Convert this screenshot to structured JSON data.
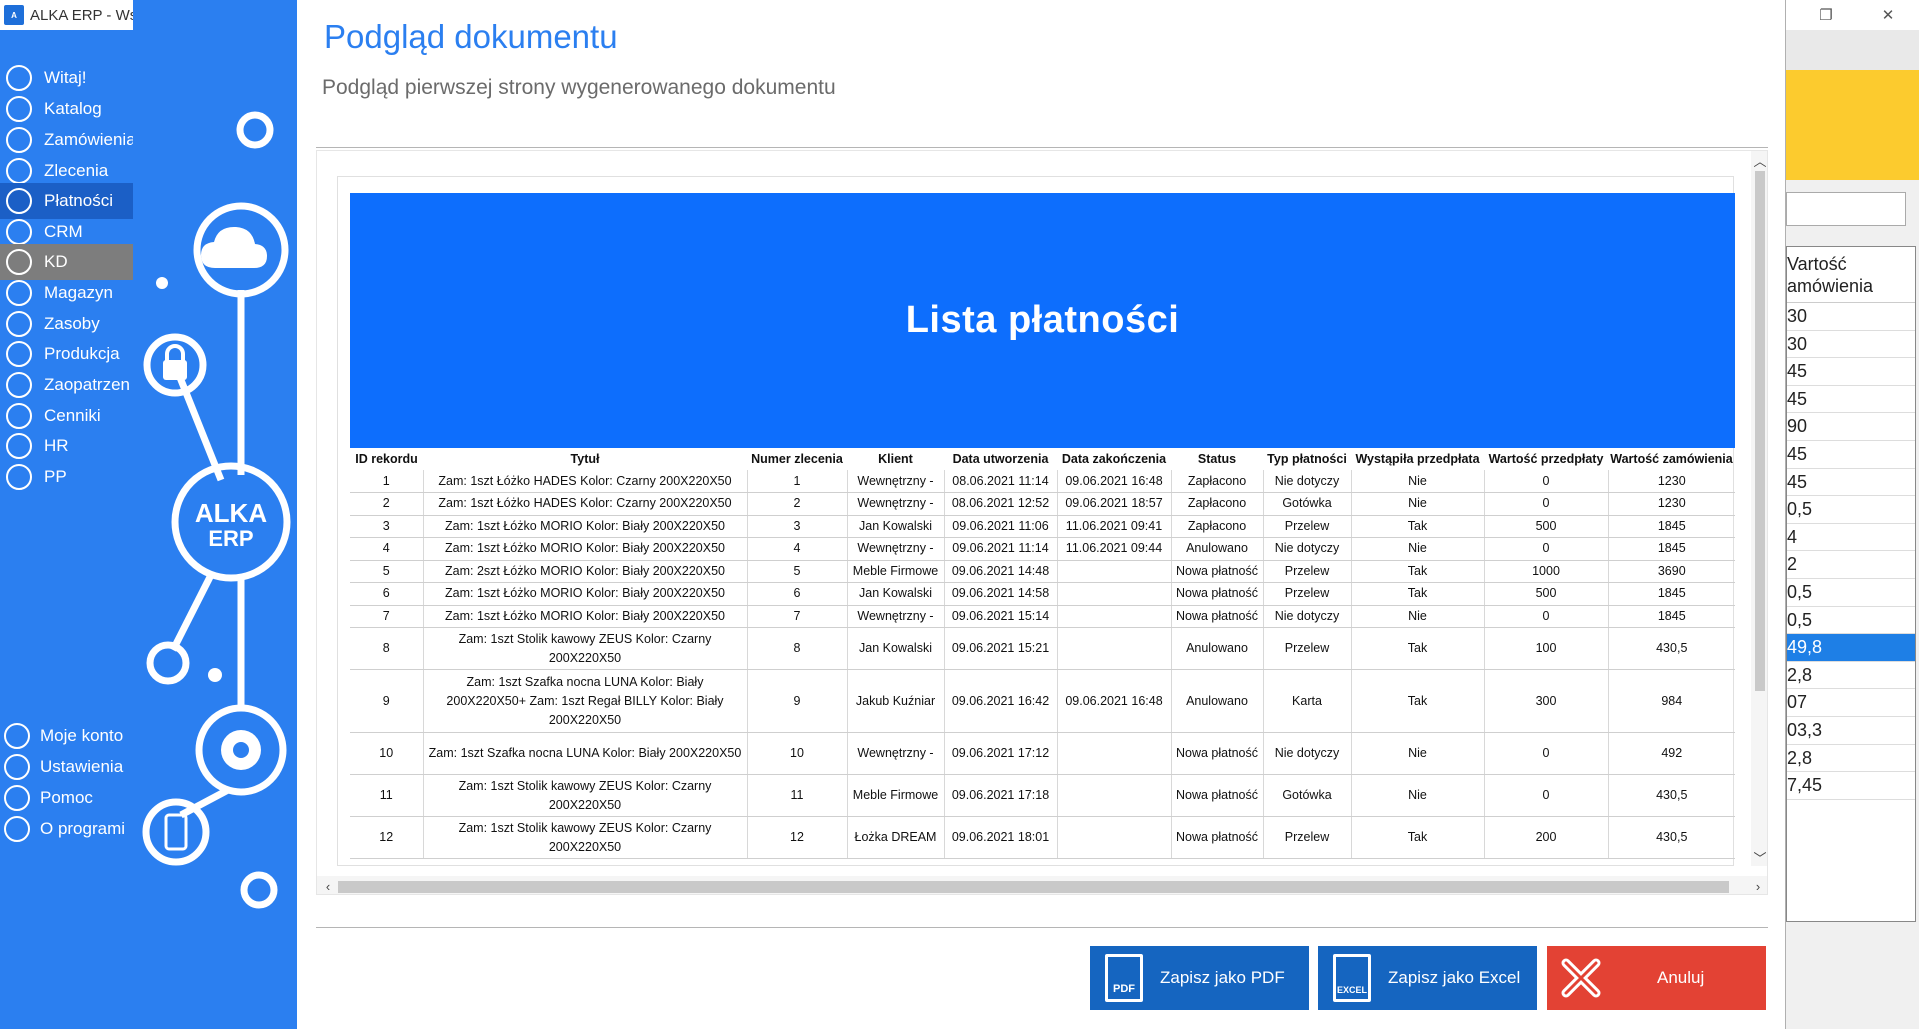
{
  "window": {
    "title": "ALKA ERP - Wsz"
  },
  "sidebar": {
    "items": [
      {
        "label": "Witaj!",
        "icon": "home-icon"
      },
      {
        "label": "Katalog",
        "icon": "book-icon"
      },
      {
        "label": "Zamówienia",
        "icon": "cart-icon"
      },
      {
        "label": "Zlecenia",
        "icon": "list-icon"
      },
      {
        "label": "Płatności",
        "icon": "dollar-icon"
      },
      {
        "label": "CRM",
        "icon": "crm-icon"
      },
      {
        "label": "KD",
        "icon": "user-icon"
      },
      {
        "label": "Magazyn",
        "icon": "warehouse-icon"
      },
      {
        "label": "Zasoby",
        "icon": "resources-icon"
      },
      {
        "label": "Produkcja",
        "icon": "production-icon"
      },
      {
        "label": "Zaopatrzen",
        "icon": "truck-icon"
      },
      {
        "label": "Cenniki",
        "icon": "tag-icon"
      },
      {
        "label": "HR",
        "icon": "hr-icon"
      },
      {
        "label": "PP",
        "icon": "pp-icon"
      }
    ],
    "bottom_items": [
      {
        "label": "Moje konto",
        "icon": "account-icon"
      },
      {
        "label": "Ustawienia",
        "icon": "settings-icon"
      },
      {
        "label": "Pomoc",
        "icon": "help-icon"
      },
      {
        "label": "O programi",
        "icon": "info-icon"
      }
    ]
  },
  "deco": {
    "logo_line1": "ALKA",
    "logo_line2": "ERP"
  },
  "background_table": {
    "header_line1": "Vartość",
    "header_line2": "amówienia",
    "values": [
      "30",
      "30",
      "45",
      "45",
      "90",
      "45",
      "45",
      "0,5",
      "4",
      "2",
      "0,5",
      "0,5",
      "49,8",
      "2,8",
      "07",
      "03,3",
      "2,8",
      "7,45"
    ],
    "selected_index": 12
  },
  "dialog": {
    "title": "Podgląd dokumentu",
    "subtitle": "Podgląd pierwszej strony wygenerowanego dokumentu"
  },
  "document": {
    "banner_title": "Lista płatności",
    "columns": [
      "ID rekordu",
      "Tytuł",
      "Numer zlecenia",
      "Klient",
      "Data utworzenia",
      "Data zakończenia",
      "Status",
      "Typ płatności",
      "Wystąpiła przedpłata",
      "Wartość przedpłaty",
      "Wartość zamówienia"
    ],
    "rows": [
      [
        "1",
        "Zam: 1szt Łóżko HADES Kolor: Czarny 200X220X50",
        "1",
        "Wewnętrzny -",
        "08.06.2021 11:14",
        "09.06.2021 16:48",
        "Zapłacono",
        "Nie dotyczy",
        "Nie",
        "0",
        "1230"
      ],
      [
        "2",
        "Zam: 1szt Łóżko HADES Kolor: Czarny 200X220X50",
        "2",
        "Wewnętrzny -",
        "08.06.2021 12:52",
        "09.06.2021 18:57",
        "Zapłacono",
        "Gotówka",
        "Nie",
        "0",
        "1230"
      ],
      [
        "3",
        "Zam: 1szt Łóżko MORIO Kolor: Biały 200X220X50",
        "3",
        "Jan Kowalski",
        "09.06.2021 11:06",
        "11.06.2021 09:41",
        "Zapłacono",
        "Przelew",
        "Tak",
        "500",
        "1845"
      ],
      [
        "4",
        "Zam: 1szt Łóżko MORIO Kolor: Biały 200X220X50",
        "4",
        "Wewnętrzny -",
        "09.06.2021 11:14",
        "11.06.2021 09:44",
        "Anulowano",
        "Nie dotyczy",
        "Nie",
        "0",
        "1845"
      ],
      [
        "5",
        "Zam: 2szt Łóżko MORIO Kolor: Biały 200X220X50",
        "5",
        "Meble Firmowe",
        "09.06.2021 14:48",
        "",
        "Nowa płatność",
        "Przelew",
        "Tak",
        "1000",
        "3690"
      ],
      [
        "6",
        "Zam: 1szt Łóżko MORIO Kolor: Biały 200X220X50",
        "6",
        "Jan Kowalski",
        "09.06.2021 14:58",
        "",
        "Nowa płatność",
        "Przelew",
        "Tak",
        "500",
        "1845"
      ],
      [
        "7",
        "Zam: 1szt Łóżko MORIO Kolor: Biały 200X220X50",
        "7",
        "Wewnętrzny -",
        "09.06.2021 15:14",
        "",
        "Nowa płatność",
        "Nie dotyczy",
        "Nie",
        "0",
        "1845"
      ],
      [
        "8",
        "Zam: 1szt Stolik kawowy ZEUS Kolor: Czarny 200X220X50",
        "8",
        "Jan Kowalski",
        "09.06.2021 15:21",
        "",
        "Anulowano",
        "Przelew",
        "Tak",
        "100",
        "430,5"
      ],
      [
        "9",
        "Zam: 1szt Szafka nocna LUNA Kolor: Biały 200X220X50+ Zam: 1szt Regał BILLY Kolor: Biały 200X220X50",
        "9",
        "Jakub Kuźniar",
        "09.06.2021 16:42",
        "09.06.2021 16:48",
        "Anulowano",
        "Karta",
        "Tak",
        "300",
        "984"
      ],
      [
        "10",
        "Zam: 1szt Szafka nocna LUNA Kolor: Biały 200X220X50",
        "10",
        "Wewnętrzny -",
        "09.06.2021 17:12",
        "",
        "Nowa płatność",
        "Nie dotyczy",
        "Nie",
        "0",
        "492"
      ],
      [
        "11",
        "Zam: 1szt Stolik kawowy ZEUS Kolor: Czarny 200X220X50",
        "11",
        "Meble Firmowe",
        "09.06.2021 17:18",
        "",
        "Nowa płatność",
        "Gotówka",
        "Nie",
        "0",
        "430,5"
      ],
      [
        "12",
        "Zam: 1szt Stolik kawowy ZEUS Kolor: Czarny 200X220X50",
        "12",
        "Łożka DREAM",
        "09.06.2021 18:01",
        "",
        "Nowa płatność",
        "Przelew",
        "Tak",
        "200",
        "430,5"
      ]
    ]
  },
  "buttons": {
    "pdf_label": "Zapisz jako PDF",
    "pdf_icon_text": "PDF",
    "excel_label": "Zapisz jako Excel",
    "excel_icon_text": "EXCEL",
    "cancel_label": "Anuluj"
  },
  "colors": {
    "accent": "#2b7ff0",
    "banner": "#0d6efd",
    "save_button": "#1565c0",
    "cancel_button": "#e34234",
    "highlight": "#fccb2e"
  }
}
